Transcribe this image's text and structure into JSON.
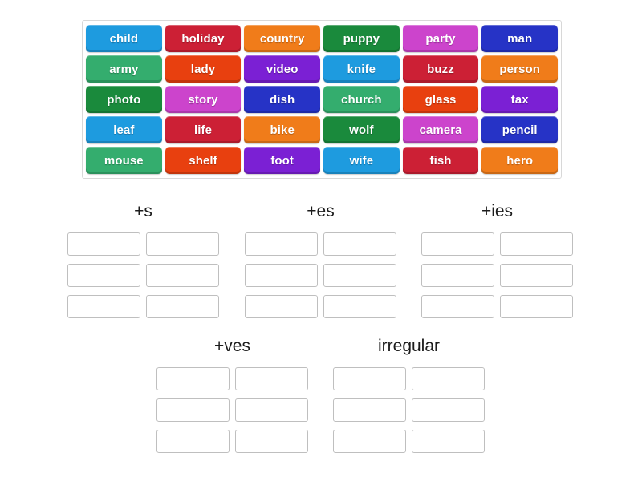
{
  "activity": {
    "type": "group-sort",
    "tile_bank": {
      "rows": [
        [
          {
            "label": "child",
            "color": "#1e9bdf"
          },
          {
            "label": "holiday",
            "color": "#cc2035"
          },
          {
            "label": "country",
            "color": "#f07c1a"
          },
          {
            "label": "puppy",
            "color": "#1a8a3c"
          },
          {
            "label": "party",
            "color": "#cc44cc"
          },
          {
            "label": "man",
            "color": "#2633c6"
          }
        ],
        [
          {
            "label": "army",
            "color": "#34ad6e"
          },
          {
            "label": "lady",
            "color": "#e8400f"
          },
          {
            "label": "video",
            "color": "#7b20d4"
          },
          {
            "label": "knife",
            "color": "#1e9bdf"
          },
          {
            "label": "buzz",
            "color": "#cc2035"
          },
          {
            "label": "person",
            "color": "#f07c1a"
          }
        ],
        [
          {
            "label": "photo",
            "color": "#1a8a3c"
          },
          {
            "label": "story",
            "color": "#cc44cc"
          },
          {
            "label": "dish",
            "color": "#2633c6"
          },
          {
            "label": "church",
            "color": "#34ad6e"
          },
          {
            "label": "glass",
            "color": "#e8400f"
          },
          {
            "label": "tax",
            "color": "#7b20d4"
          }
        ],
        [
          {
            "label": "leaf",
            "color": "#1e9bdf"
          },
          {
            "label": "life",
            "color": "#cc2035"
          },
          {
            "label": "bike",
            "color": "#f07c1a"
          },
          {
            "label": "wolf",
            "color": "#1a8a3c"
          },
          {
            "label": "camera",
            "color": "#cc44cc"
          },
          {
            "label": "pencil",
            "color": "#2633c6"
          }
        ],
        [
          {
            "label": "mouse",
            "color": "#34ad6e"
          },
          {
            "label": "shelf",
            "color": "#e8400f"
          },
          {
            "label": "foot",
            "color": "#7b20d4"
          },
          {
            "label": "wife",
            "color": "#1e9bdf"
          },
          {
            "label": "fish",
            "color": "#cc2035"
          },
          {
            "label": "hero",
            "color": "#f07c1a"
          }
        ]
      ]
    },
    "categories": [
      {
        "id": "s",
        "title": "+s",
        "rows": 3,
        "cols": 2,
        "values": [
          [
            "",
            ""
          ],
          [
            "",
            ""
          ],
          [
            "",
            ""
          ]
        ]
      },
      {
        "id": "es",
        "title": "+es",
        "rows": 3,
        "cols": 2,
        "values": [
          [
            "",
            ""
          ],
          [
            "",
            ""
          ],
          [
            "",
            ""
          ]
        ]
      },
      {
        "id": "ies",
        "title": "+ies",
        "rows": 3,
        "cols": 2,
        "values": [
          [
            "",
            ""
          ],
          [
            "",
            ""
          ],
          [
            "",
            ""
          ]
        ]
      },
      {
        "id": "ves",
        "title": "+ves",
        "rows": 3,
        "cols": 2,
        "values": [
          [
            "",
            ""
          ],
          [
            "",
            ""
          ],
          [
            "",
            ""
          ]
        ]
      },
      {
        "id": "irregular",
        "title": "irregular",
        "rows": 3,
        "cols": 2,
        "values": [
          [
            "",
            ""
          ],
          [
            "",
            ""
          ],
          [
            "",
            ""
          ]
        ]
      }
    ]
  }
}
